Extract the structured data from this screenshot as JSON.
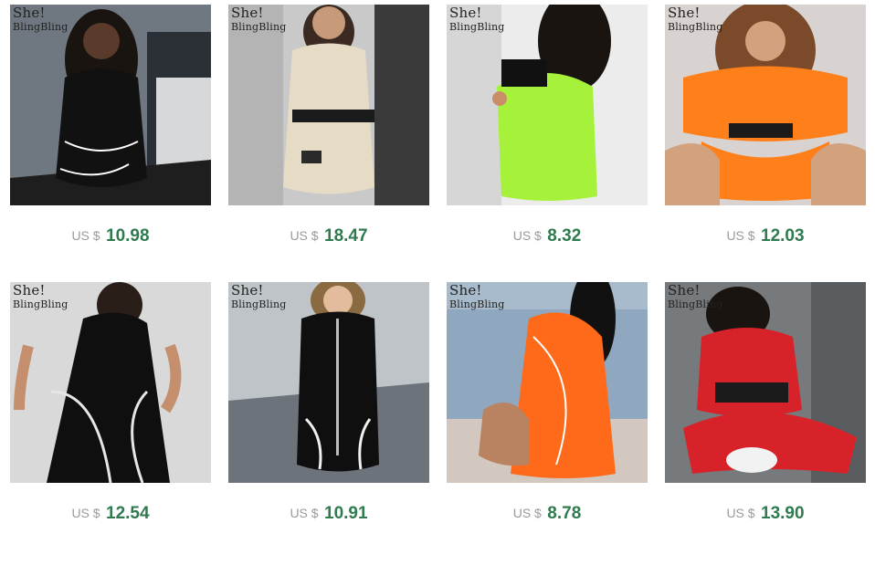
{
  "brand_logo": {
    "line1": "She!",
    "line2": "BlingBling"
  },
  "currency_label": "US $",
  "products": [
    {
      "price": "10.98",
      "accent": "#111111",
      "bg": "#6f7780",
      "skin": "#5a3a2a",
      "hair": "#1a1410"
    },
    {
      "price": "18.47",
      "accent": "#e6dcc6",
      "bg": "#c9c9c9",
      "skin": "#c79a7a",
      "hair": "#3a2a22"
    },
    {
      "price": "8.32",
      "accent": "#a6f23a",
      "bg": "#ececec",
      "skin": "#c98d68",
      "hair": "#1a1410"
    },
    {
      "price": "12.03",
      "accent": "#ff7f1a",
      "bg": "#d8d3d0",
      "skin": "#d2a27e",
      "hair": "#7a4a2a"
    },
    {
      "price": "12.54",
      "accent": "#0f0f0f",
      "bg": "#d9d9d9",
      "skin": "#c58f6e",
      "hair": "#2a1e18"
    },
    {
      "price": "10.91",
      "accent": "#0f0f0f",
      "bg": "#bfc4c8",
      "skin": "#e2bc9c",
      "hair": "#8a6a40"
    },
    {
      "price": "8.78",
      "accent": "#ff6a1a",
      "bg": "#8fa8c0",
      "skin": "#b98260",
      "hair": "#111111"
    },
    {
      "price": "13.90",
      "accent": "#d8222a",
      "bg": "#777a7d",
      "skin": "#d0a486",
      "hair": "#1a1410"
    }
  ]
}
